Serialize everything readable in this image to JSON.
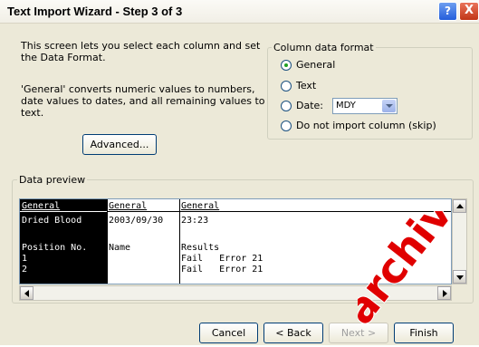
{
  "window": {
    "title": "Text Import Wizard - Step 3 of 3"
  },
  "titlebar": {
    "help_label": "?",
    "close_label": "X"
  },
  "description": {
    "line1": "This screen lets you select each column and set the Data Format.",
    "line2": "'General' converts numeric values to numbers, date values to dates, and all remaining values to text."
  },
  "advanced_button": {
    "label": "Advanced..."
  },
  "column_data_format": {
    "legend": "Column data format",
    "options": [
      {
        "label": "General",
        "selected": true
      },
      {
        "label": "Text",
        "selected": false
      },
      {
        "label": "Date:",
        "selected": false
      },
      {
        "label": "Do not import column (skip)",
        "selected": false
      }
    ],
    "date_select_value": "MDY"
  },
  "preview": {
    "legend": "Data preview",
    "headers": [
      "General",
      "General",
      "General"
    ],
    "rows": [
      [
        "Dried Blood",
        "2003/09/30",
        "23:23"
      ],
      [
        "",
        "",
        ""
      ],
      [
        "Position No.",
        "Name",
        "Results"
      ],
      [
        "1",
        "",
        "Fail   Error 21"
      ],
      [
        "2",
        "",
        "Fail   Error 21"
      ]
    ]
  },
  "buttons": {
    "cancel": "Cancel",
    "back": "< Back",
    "next": "Next >",
    "finish": "Finish"
  },
  "watermark": {
    "text": "archived"
  },
  "colors": {
    "selected_column_bg": "#000000",
    "dialog_bg": "#ece9d8",
    "watermark": "#e00000"
  }
}
